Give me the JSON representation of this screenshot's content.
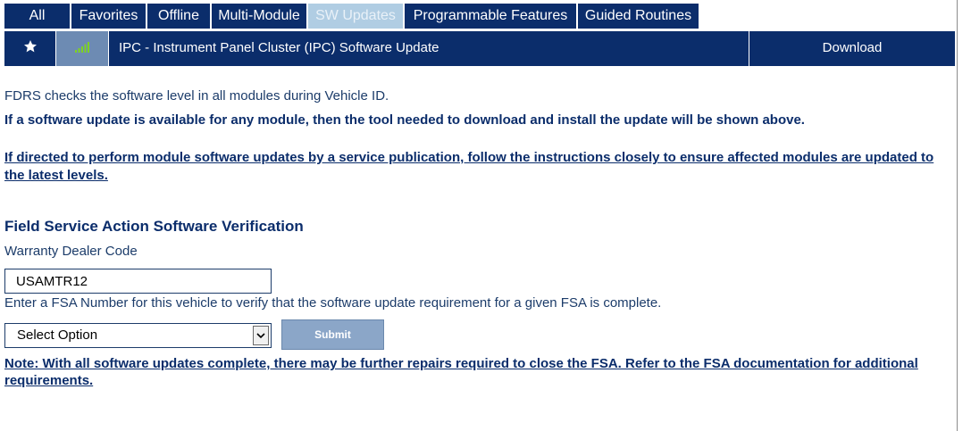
{
  "tabs": [
    {
      "label": "All",
      "active": false
    },
    {
      "label": "Favorites",
      "active": false
    },
    {
      "label": "Offline",
      "active": false
    },
    {
      "label": "Multi-Module",
      "active": false
    },
    {
      "label": "SW Updates",
      "active": true
    },
    {
      "label": "Programmable Features",
      "active": false
    },
    {
      "label": "Guided Routines",
      "active": false
    }
  ],
  "update_row": {
    "favorite_icon": "star-icon",
    "signal_icon": "signal-bars-icon",
    "module_name": "IPC - Instrument Panel Cluster (IPC) Software Update",
    "action_label": "Download"
  },
  "info": {
    "intro": "FDRS checks the software level in all modules during Vehicle ID.",
    "bold_note": "If a software update is available for any module, then the tool needed to download and install the update will be shown above.",
    "link_note": "If directed to perform module software updates by a service publication, follow the instructions closely to ensure affected modules are updated to the latest levels."
  },
  "fsa": {
    "title": "Field Service Action Software Verification",
    "dealer_code_label": "Warranty Dealer Code",
    "dealer_code_value": "USAMTR12",
    "instruction": "Enter a FSA Number for this vehicle to verify that the software update requirement for a given FSA is complete.",
    "select_value": "Select Option",
    "submit_label": "Submit",
    "note": "Note: With all software updates complete, there may be further repairs required to close the FSA. Refer to the FSA documentation for additional requirements."
  },
  "colors": {
    "navy": "#0b2d6b",
    "active_tab": "#b0cde3",
    "signal_cell": "#6d8bb3",
    "signal_green": "#7ed321",
    "submit_bg": "#8ba6c8"
  }
}
